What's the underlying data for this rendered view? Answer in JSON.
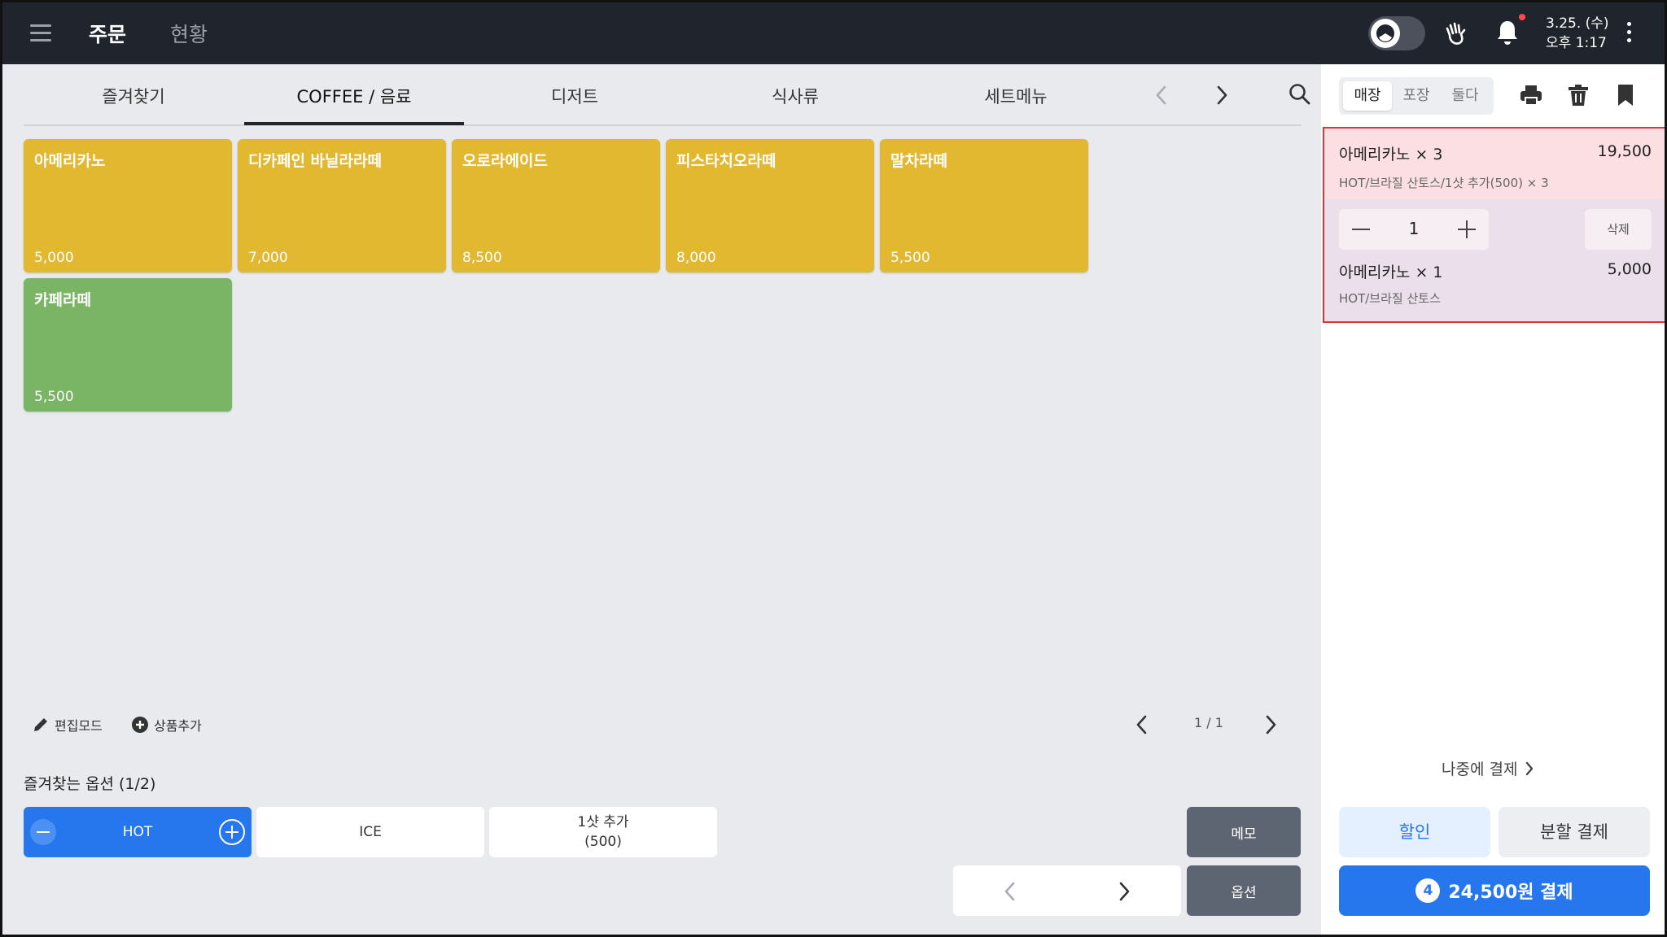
{
  "header": {
    "nav_order": "주문",
    "nav_status": "현황",
    "date": "3.25. (수)",
    "time": "오후 1:17"
  },
  "categories": {
    "tabs": [
      {
        "label": "즐겨찾기"
      },
      {
        "label": "COFFEE / 음료",
        "active": true
      },
      {
        "label": "디저트"
      },
      {
        "label": "식사류"
      },
      {
        "label": "세트메뉴"
      }
    ]
  },
  "products": [
    {
      "name": "아메리카노",
      "price": "5,000",
      "color": "#e2b830"
    },
    {
      "name": "디카페인 바닐라라떼",
      "price": "7,000",
      "color": "#e2b830"
    },
    {
      "name": "오로라에이드",
      "price": "8,500",
      "color": "#e2b830"
    },
    {
      "name": "피스타치오라떼",
      "price": "8,000",
      "color": "#e2b830"
    },
    {
      "name": "말차라떼",
      "price": "5,500",
      "color": "#e2b830"
    },
    {
      "name": "카페라떼",
      "price": "5,500",
      "color": "#79b564"
    }
  ],
  "tools": {
    "edit_mode": "편집모드",
    "add_product": "상품추가",
    "page": "1 / 1"
  },
  "favorites": {
    "title": "즐겨찾는 옵션 (1/2)",
    "options": [
      {
        "label": "HOT",
        "selected": true
      },
      {
        "label": "ICE"
      },
      {
        "label": "1샷 추가",
        "sub": "(500)"
      }
    ],
    "memo": "메모",
    "option": "옵션"
  },
  "order": {
    "segments": [
      "매장",
      "포장",
      "둘다"
    ],
    "active_segment": "매장",
    "items": [
      {
        "name": "아메리카노 × 3",
        "price": "19,500",
        "options": "HOT/브라질 산토스/1샷 추가(500) × 3"
      },
      {
        "name": "아메리카노 × 1",
        "price": "5,000",
        "options": "HOT/브라질 산토스"
      }
    ],
    "qty": "1",
    "delete_label": "삭제",
    "pay_later": "나중에 결제",
    "discount": "할인",
    "split_pay": "분할 결제",
    "pay_count": "4",
    "pay_label": "24,500원 결제"
  },
  "colors": {
    "topbar": "#20242c",
    "accent": "#2676ee",
    "highlight_border": "#e0323a"
  }
}
